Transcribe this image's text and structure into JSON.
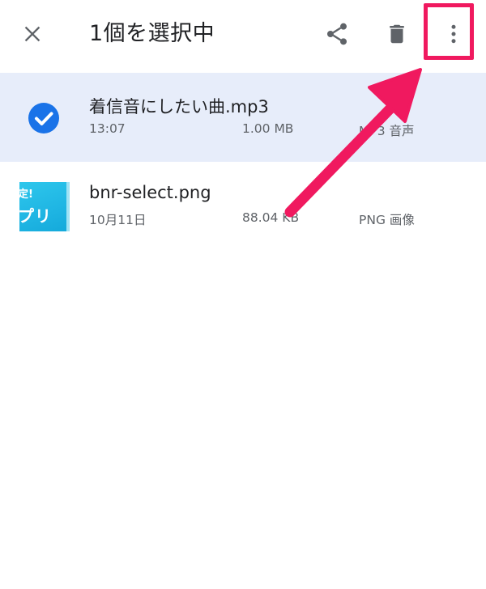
{
  "header": {
    "title": "1個を選択中",
    "close_icon": "close-icon",
    "share_icon": "share-icon",
    "delete_icon": "trash-icon",
    "more_icon": "more-vert-icon"
  },
  "files": [
    {
      "name": "着信音にしたい曲.mp3",
      "date": "13:07",
      "size": "1.00 MB",
      "type": "MP3 音声",
      "selected": true,
      "icon": "check-circle-icon"
    },
    {
      "name": "bnr-select.png",
      "date": "10月11日",
      "size": "88.04 KB",
      "type": "PNG 画像",
      "selected": false,
      "thumbnail_text_1": "定!",
      "thumbnail_text_2": "プリ"
    }
  ],
  "colors": {
    "selection_bg": "#e7edfa",
    "check_blue": "#1a73e8",
    "annotation_pink": "#f0195f"
  }
}
